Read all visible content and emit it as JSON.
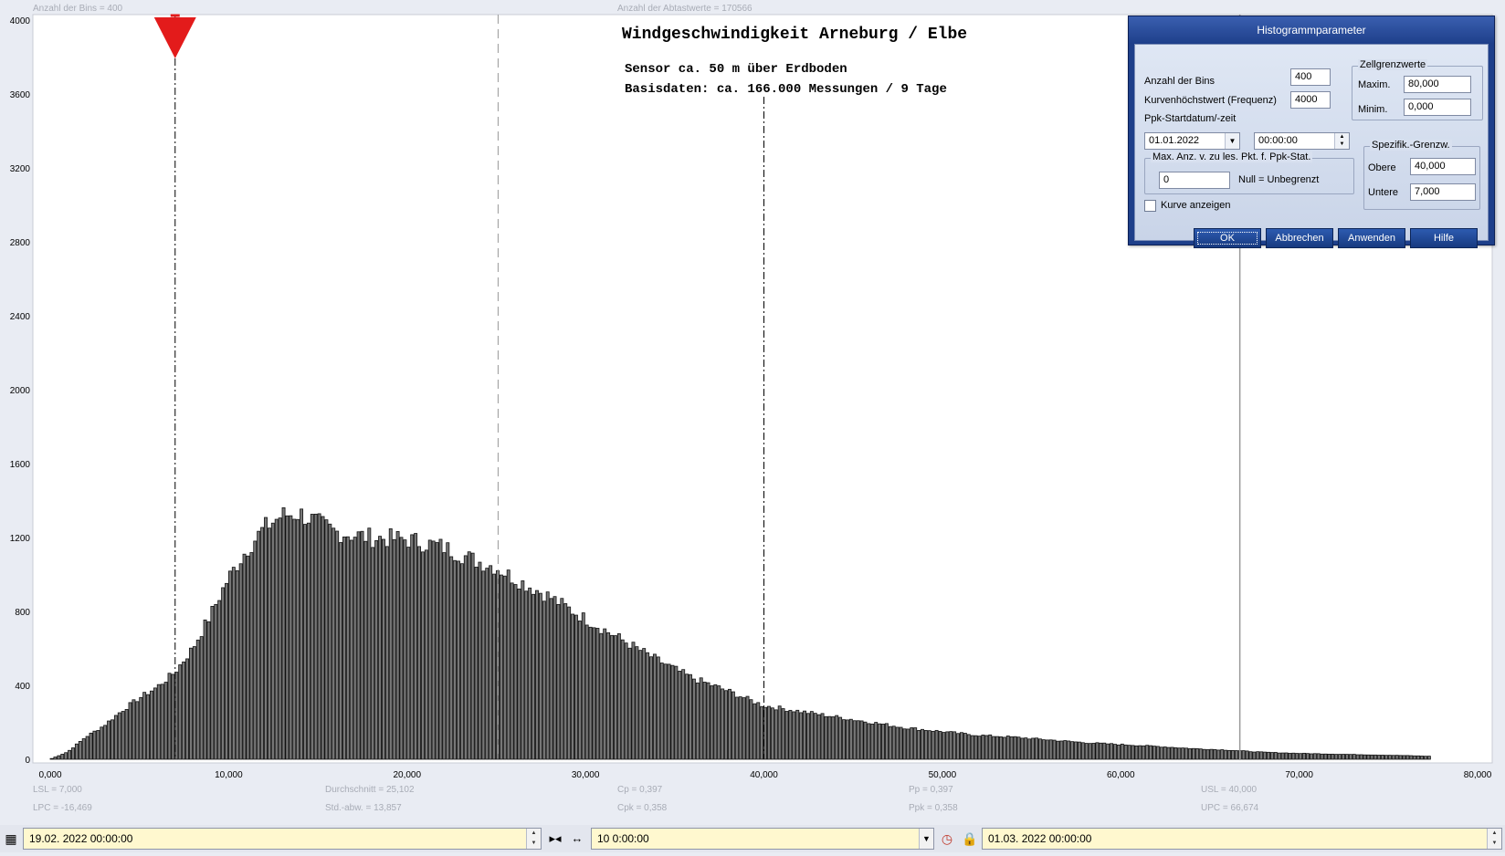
{
  "header": {
    "bins_label": "Anzahl der Bins =   400",
    "samples_label": "Anzahl der Abtastwerte = 170566"
  },
  "chart": {
    "title": "Windgeschwindigkeit  Arneburg / Elbe",
    "line1": "Sensor ca. 50 m über Erdboden",
    "line2": "Basisdaten:  ca. 166.000 Messungen / 9 Tage"
  },
  "chart_data": {
    "type": "bar",
    "xlim": [
      0,
      80
    ],
    "ylim": [
      0,
      4000
    ],
    "x_ticks": [
      "0,000",
      "10,000",
      "20,000",
      "30,000",
      "40,000",
      "50,000",
      "60,000",
      "70,000",
      "80,000"
    ],
    "y_ticks": [
      "0",
      "400",
      "800",
      "1200",
      "1600",
      "2000",
      "2400",
      "2800",
      "3200",
      "3600",
      "4000"
    ],
    "bin_width": 0.2,
    "bin_range": [
      0,
      77.4
    ],
    "grid": false,
    "envelope": [
      [
        0,
        0
      ],
      [
        1,
        40
      ],
      [
        2,
        120
      ],
      [
        3,
        180
      ],
      [
        4,
        260
      ],
      [
        5,
        330
      ],
      [
        6,
        390
      ],
      [
        7,
        470
      ],
      [
        8,
        600
      ],
      [
        9,
        780
      ],
      [
        10,
        980
      ],
      [
        11,
        1130
      ],
      [
        12,
        1250
      ],
      [
        13,
        1320
      ],
      [
        14,
        1330
      ],
      [
        15,
        1280
      ],
      [
        16,
        1230
      ],
      [
        18,
        1200
      ],
      [
        20,
        1190
      ],
      [
        22,
        1150
      ],
      [
        24,
        1070
      ],
      [
        25,
        1040
      ],
      [
        26,
        980
      ],
      [
        28,
        880
      ],
      [
        30,
        760
      ],
      [
        32,
        650
      ],
      [
        34,
        540
      ],
      [
        36,
        440
      ],
      [
        38,
        370
      ],
      [
        40,
        290
      ],
      [
        42,
        260
      ],
      [
        44,
        230
      ],
      [
        46,
        200
      ],
      [
        48,
        170
      ],
      [
        50,
        150
      ],
      [
        52,
        130
      ],
      [
        54,
        120
      ],
      [
        56,
        105
      ],
      [
        58,
        90
      ],
      [
        60,
        80
      ],
      [
        62,
        70
      ],
      [
        64,
        58
      ],
      [
        66,
        50
      ],
      [
        68,
        38
      ],
      [
        70,
        32
      ],
      [
        72,
        28
      ],
      [
        74,
        24
      ],
      [
        76,
        20
      ],
      [
        77.4,
        16
      ]
    ],
    "markers": [
      {
        "name": "LSL",
        "x": 7.0,
        "style": "dash-dot"
      },
      {
        "name": "Durchschnitt",
        "x": 25.102,
        "style": "dashed"
      },
      {
        "name": "USL",
        "x": 40.0,
        "style": "dash-dot"
      },
      {
        "name": "UPC",
        "x": 66.674,
        "style": "solid"
      }
    ],
    "pointer_x": 7.0,
    "bar_color": "#777777",
    "bar_edge_color": "#111111",
    "marker_color": "#e31b1b"
  },
  "stats": {
    "lsl": "LSL = 7,000",
    "lpc": "LPC = -16,469",
    "mean": "Durchschnitt  = 25,102",
    "std": "Std.-abw. = 13,857",
    "cp": "Cp  = 0,397",
    "cpk": "Cpk = 0,358",
    "pp": "Pp  = 0,397",
    "ppk": "Ppk = 0,358",
    "usl": "USL = 40,000",
    "upc": "UPC = 66,674"
  },
  "dialog": {
    "title": "Histogrammparameter",
    "bins_label": "Anzahl der Bins",
    "bins_value": "400",
    "curve_max_label": "Kurvenhöchstwert (Frequenz)",
    "curve_max_value": "4000",
    "ppk_start_label": "Ppk-Startdatum/-zeit",
    "start_date": "01.01.2022",
    "start_time": "00:00:00",
    "cell_limits_title": "Zellgrenzwerte",
    "max_label": "Maxim.",
    "max_value": "80,000",
    "min_label": "Minim.",
    "min_value": "0,000",
    "maxpts_title": "Max. Anz. v. zu les. Pkt. f. Ppk-Stat.",
    "maxpts_value": "0",
    "null_label": "Null = Unbegrenzt",
    "spec_title": "Spezifik.-Grenzw.",
    "upper_label": "Obere",
    "upper_value": "40,000",
    "lower_label": "Untere",
    "lower_value": "7,000",
    "curve_checkbox_label": "Kurve anzeigen",
    "ok": "OK",
    "cancel": "Abbrechen",
    "apply": "Anwenden",
    "help": "Hilfe"
  },
  "toolbar": {
    "start": "19.02. 2022   00:00:00",
    "duration": "10  0:00:00",
    "end": "01.03. 2022   00:00:00"
  }
}
